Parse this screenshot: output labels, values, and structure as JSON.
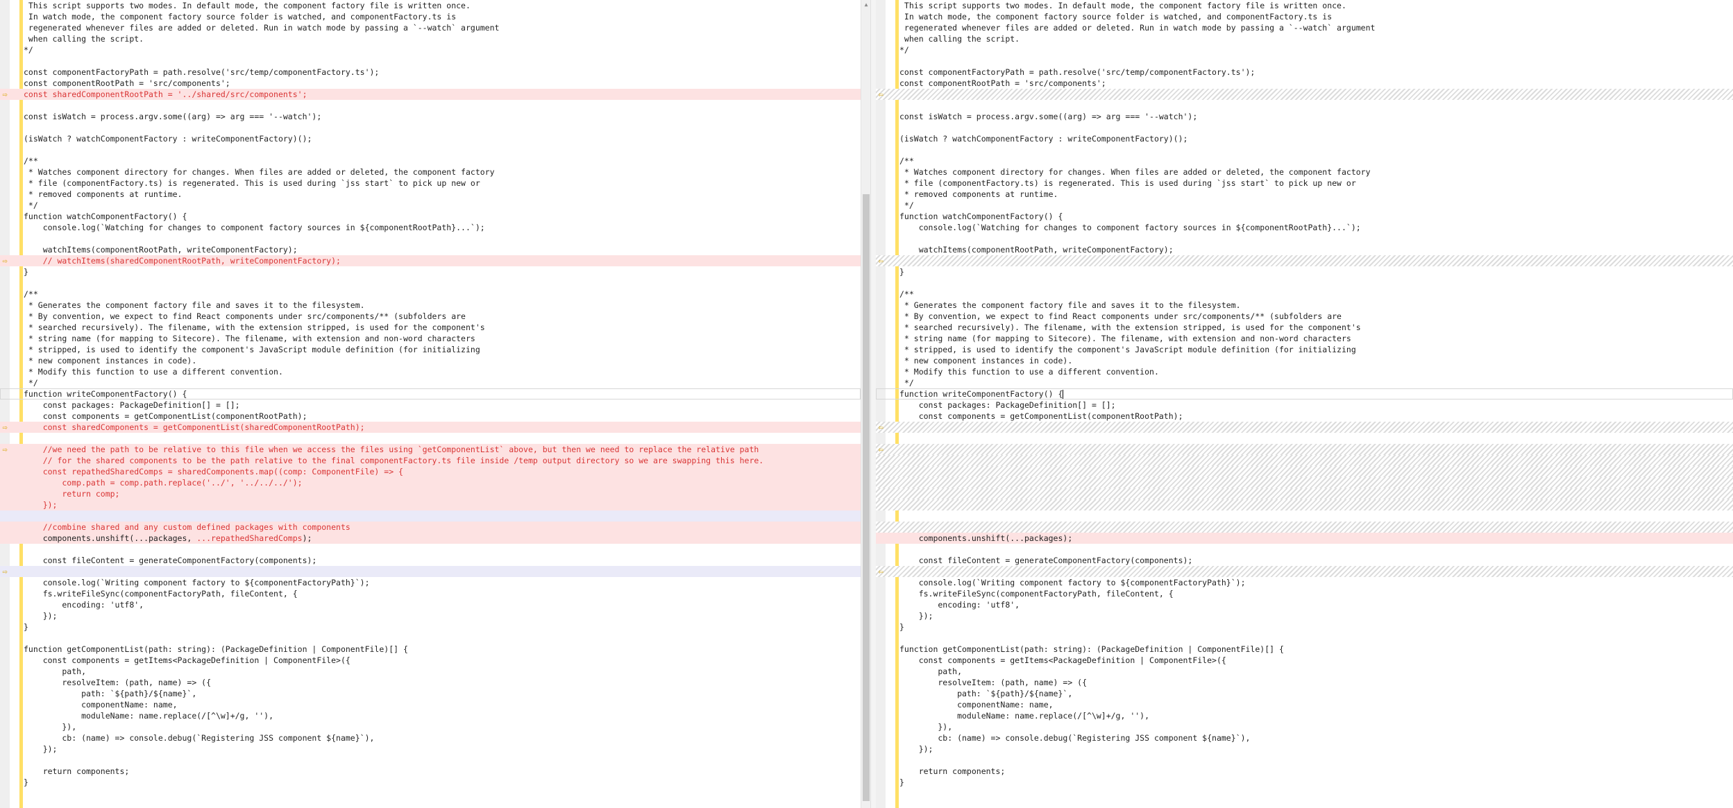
{
  "colors": {
    "change_bar": "#ffe066",
    "deleted_text": "#d93535",
    "deleted_bg": "#fde2e2",
    "arrow": "#d6a400"
  },
  "left": {
    "lines": [
      {
        "t": " This script supports two modes. In default mode, the component factory file is written once."
      },
      {
        "t": " In watch mode, the component factory source folder is watched, and componentFactory.ts is"
      },
      {
        "t": " regenerated whenever files are added or deleted. Run in watch mode by passing a `--watch` argument"
      },
      {
        "t": " when calling the script."
      },
      {
        "t": "*/"
      },
      {
        "t": ""
      },
      {
        "t": "const componentFactoryPath = path.resolve('src/temp/componentFactory.ts');"
      },
      {
        "t": "const componentRootPath = 'src/components';"
      },
      {
        "t": "const sharedComponentRootPath = '../shared/src/components';",
        "k": "del",
        "a": true
      },
      {
        "t": ""
      },
      {
        "t": "const isWatch = process.argv.some((arg) => arg === '--watch');"
      },
      {
        "t": ""
      },
      {
        "t": "(isWatch ? watchComponentFactory : writeComponentFactory)();"
      },
      {
        "t": ""
      },
      {
        "t": "/**"
      },
      {
        "t": " * Watches component directory for changes. When files are added or deleted, the component factory"
      },
      {
        "t": " * file (componentFactory.ts) is regenerated. This is used during `jss start` to pick up new or"
      },
      {
        "t": " * removed components at runtime."
      },
      {
        "t": " */"
      },
      {
        "t": "function watchComponentFactory() {"
      },
      {
        "t": "    console.log(`Watching for changes to component factory sources in ${componentRootPath}...`);"
      },
      {
        "t": ""
      },
      {
        "t": "    watchItems(componentRootPath, writeComponentFactory);"
      },
      {
        "t": "    // watchItems(sharedComponentRootPath, writeComponentFactory);",
        "k": "del",
        "a": true
      },
      {
        "t": "}"
      },
      {
        "t": ""
      },
      {
        "t": "/**"
      },
      {
        "t": " * Generates the component factory file and saves it to the filesystem."
      },
      {
        "t": " * By convention, we expect to find React components under src/components/** (subfolders are"
      },
      {
        "t": " * searched recursively). The filename, with the extension stripped, is used for the component's"
      },
      {
        "t": " * string name (for mapping to Sitecore). The filename, with extension and non-word characters"
      },
      {
        "t": " * stripped, is used to identify the component's JavaScript module definition (for initializing"
      },
      {
        "t": " * new component instances in code)."
      },
      {
        "t": " * Modify this function to use a different convention."
      },
      {
        "t": " */"
      },
      {
        "t": "function writeComponentFactory() {",
        "k": "current"
      },
      {
        "t": "    const packages: PackageDefinition[] = [];"
      },
      {
        "t": "    const components = getComponentList(componentRootPath);"
      },
      {
        "t": "    const sharedComponents = getComponentList(sharedComponentRootPath);",
        "k": "del",
        "a": true
      },
      {
        "t": ""
      },
      {
        "t": "    //we need the path to be relative to this file when we access the files using `getComponentList` above, but then we need to replace the relative path",
        "k": "del",
        "a": true
      },
      {
        "t": "    // for the shared components to be the path relative to the final componentFactory.ts file inside /temp output directory so we are swapping this here.",
        "k": "del"
      },
      {
        "t": "    const repathedSharedComps = sharedComponents.map((comp: ComponentFile) => {",
        "k": "del"
      },
      {
        "t": "        comp.path = comp.path.replace('../', '../../../');",
        "k": "del"
      },
      {
        "t": "        return comp;",
        "k": "del"
      },
      {
        "t": "    });",
        "k": "del"
      },
      {
        "t": "",
        "k": "blank"
      },
      {
        "t": "    //combine shared and any custom defined packages with components",
        "k": "del"
      },
      {
        "t": "    components.unshift(...packages, ",
        "h": "...repathedSharedComps",
        "e": ");",
        "k": "mod"
      },
      {
        "t": ""
      },
      {
        "t": "    const fileContent = generateComponentFactory(components);"
      },
      {
        "t": "",
        "k": "blank",
        "a": true
      },
      {
        "t": "    console.log(`Writing component factory to ${componentFactoryPath}`);"
      },
      {
        "t": "    fs.writeFileSync(componentFactoryPath, fileContent, {"
      },
      {
        "t": "        encoding: 'utf8',"
      },
      {
        "t": "    });"
      },
      {
        "t": "}"
      },
      {
        "t": ""
      },
      {
        "t": "function getComponentList(path: string): (PackageDefinition | ComponentFile)[] {"
      },
      {
        "t": "    const components = getItems<PackageDefinition | ComponentFile>({"
      },
      {
        "t": "        path,"
      },
      {
        "t": "        resolveItem: (path, name) => ({"
      },
      {
        "t": "            path: `${path}/${name}`,"
      },
      {
        "t": "            componentName: name,"
      },
      {
        "t": "            moduleName: name.replace(/[^\\w]+/g, ''),"
      },
      {
        "t": "        }),"
      },
      {
        "t": "        cb: (name) => console.debug(`Registering JSS component ${name}`),"
      },
      {
        "t": "    });"
      },
      {
        "t": ""
      },
      {
        "t": "    return components;"
      },
      {
        "t": "}"
      }
    ]
  },
  "right": {
    "lines": [
      {
        "t": " This script supports two modes. In default mode, the component factory file is written once."
      },
      {
        "t": " In watch mode, the component factory source folder is watched, and componentFactory.ts is"
      },
      {
        "t": " regenerated whenever files are added or deleted. Run in watch mode by passing a `--watch` argument"
      },
      {
        "t": " when calling the script."
      },
      {
        "t": "*/"
      },
      {
        "t": ""
      },
      {
        "t": "const componentFactoryPath = path.resolve('src/temp/componentFactory.ts');"
      },
      {
        "t": "const componentRootPath = 'src/components';"
      },
      {
        "t": "",
        "k": "hatch",
        "a": true
      },
      {
        "t": ""
      },
      {
        "t": "const isWatch = process.argv.some((arg) => arg === '--watch');"
      },
      {
        "t": ""
      },
      {
        "t": "(isWatch ? watchComponentFactory : writeComponentFactory)();"
      },
      {
        "t": ""
      },
      {
        "t": "/**"
      },
      {
        "t": " * Watches component directory for changes. When files are added or deleted, the component factory"
      },
      {
        "t": " * file (componentFactory.ts) is regenerated. This is used during `jss start` to pick up new or"
      },
      {
        "t": " * removed components at runtime."
      },
      {
        "t": " */"
      },
      {
        "t": "function watchComponentFactory() {"
      },
      {
        "t": "    console.log(`Watching for changes to component factory sources in ${componentRootPath}...`);"
      },
      {
        "t": ""
      },
      {
        "t": "    watchItems(componentRootPath, writeComponentFactory);"
      },
      {
        "t": "",
        "k": "hatch",
        "a": true
      },
      {
        "t": "}"
      },
      {
        "t": ""
      },
      {
        "t": "/**"
      },
      {
        "t": " * Generates the component factory file and saves it to the filesystem."
      },
      {
        "t": " * By convention, we expect to find React components under src/components/** (subfolders are"
      },
      {
        "t": " * searched recursively). The filename, with the extension stripped, is used for the component's"
      },
      {
        "t": " * string name (for mapping to Sitecore). The filename, with extension and non-word characters"
      },
      {
        "t": " * stripped, is used to identify the component's JavaScript module definition (for initializing"
      },
      {
        "t": " * new component instances in code)."
      },
      {
        "t": " * Modify this function to use a different convention."
      },
      {
        "t": " */"
      },
      {
        "t": "function writeComponentFactory() {",
        "k": "current",
        "c": true
      },
      {
        "t": "    const packages: PackageDefinition[] = [];"
      },
      {
        "t": "    const components = getComponentList(componentRootPath);"
      },
      {
        "t": "",
        "k": "hatch",
        "a": true
      },
      {
        "t": ""
      },
      {
        "t": "",
        "k": "hatch",
        "a": true
      },
      {
        "t": "",
        "k": "hatch"
      },
      {
        "t": "",
        "k": "hatch"
      },
      {
        "t": "",
        "k": "hatch"
      },
      {
        "t": "",
        "k": "hatch"
      },
      {
        "t": "",
        "k": "hatch"
      },
      {
        "t": ""
      },
      {
        "t": "",
        "k": "hatch"
      },
      {
        "t": "    components.unshift(...packages);",
        "k": "mod"
      },
      {
        "t": ""
      },
      {
        "t": "    const fileContent = generateComponentFactory(components);"
      },
      {
        "t": "",
        "k": "hatch",
        "a": true
      },
      {
        "t": "    console.log(`Writing component factory to ${componentFactoryPath}`);"
      },
      {
        "t": "    fs.writeFileSync(componentFactoryPath, fileContent, {"
      },
      {
        "t": "        encoding: 'utf8',"
      },
      {
        "t": "    });"
      },
      {
        "t": "}"
      },
      {
        "t": ""
      },
      {
        "t": "function getComponentList(path: string): (PackageDefinition | ComponentFile)[] {"
      },
      {
        "t": "    const components = getItems<PackageDefinition | ComponentFile>({"
      },
      {
        "t": "        path,"
      },
      {
        "t": "        resolveItem: (path, name) => ({"
      },
      {
        "t": "            path: `${path}/${name}`,"
      },
      {
        "t": "            componentName: name,"
      },
      {
        "t": "            moduleName: name.replace(/[^\\w]+/g, ''),"
      },
      {
        "t": "        }),"
      },
      {
        "t": "        cb: (name) => console.debug(`Registering JSS component ${name}`),"
      },
      {
        "t": "    });"
      },
      {
        "t": ""
      },
      {
        "t": "    return components;"
      },
      {
        "t": "}"
      }
    ]
  }
}
